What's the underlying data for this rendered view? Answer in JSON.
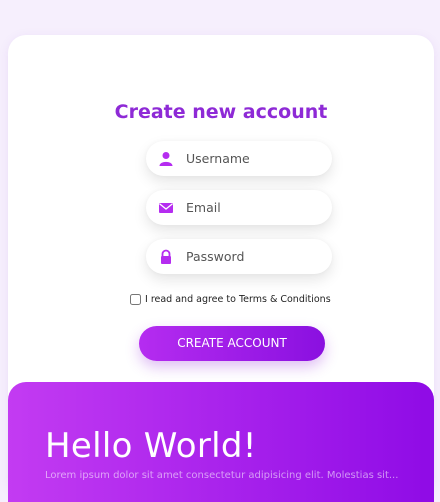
{
  "form": {
    "title": "Create new account",
    "fields": [
      {
        "icon": "user-icon",
        "placeholder": "Username",
        "value": ""
      },
      {
        "icon": "mail-icon",
        "placeholder": "Email",
        "value": ""
      },
      {
        "icon": "lock-icon",
        "placeholder": "Password",
        "value": ""
      }
    ],
    "terms_label": "I read and agree to Terms & Conditions",
    "terms_checked": false,
    "submit_label": "CREATE ACCOUNT"
  },
  "hero": {
    "heading": "Hello World!",
    "body": "Lorem ipsum dolor sit amet consectetur adipisicing elit. Molestias sit..."
  },
  "colors": {
    "accent": "#8e2ad6",
    "icon": "#b52cf0",
    "gradient_start": "#c33bf2",
    "gradient_end": "#8f0be6",
    "background": "#f6effd"
  }
}
